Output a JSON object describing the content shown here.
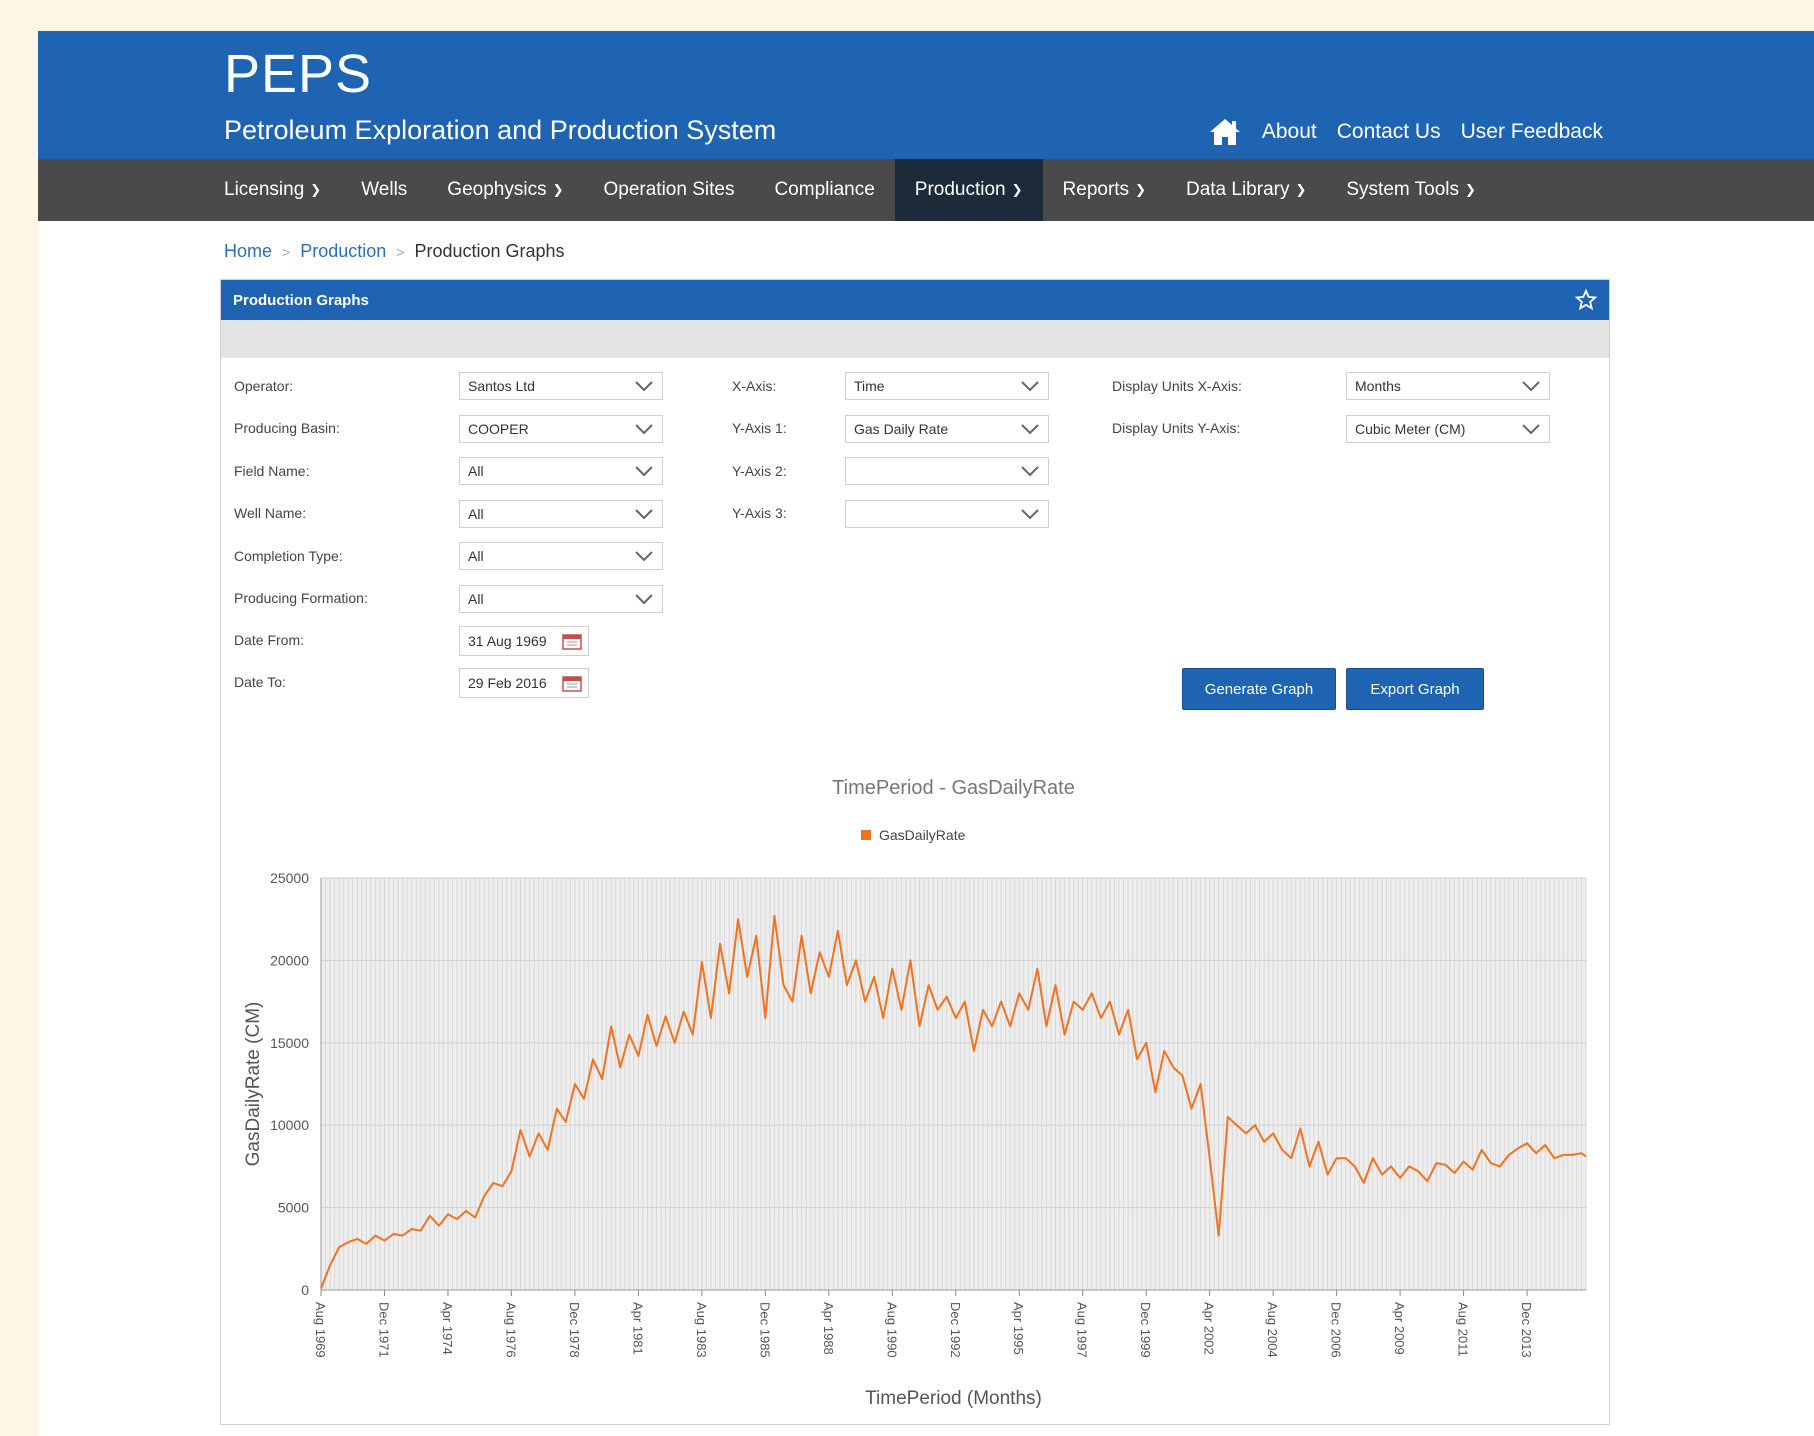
{
  "header": {
    "title": "PEPS",
    "subtitle": "Petroleum Exploration and Production System",
    "links": [
      "About",
      "Contact Us",
      "User Feedback"
    ]
  },
  "nav": {
    "items": [
      {
        "label": "Licensing",
        "dropdown": true
      },
      {
        "label": "Wells",
        "dropdown": false
      },
      {
        "label": "Geophysics",
        "dropdown": true
      },
      {
        "label": "Operation Sites",
        "dropdown": false
      },
      {
        "label": "Compliance",
        "dropdown": false
      },
      {
        "label": "Production",
        "dropdown": true,
        "active": true
      },
      {
        "label": "Reports",
        "dropdown": true
      },
      {
        "label": "Data Library",
        "dropdown": true
      },
      {
        "label": "System Tools",
        "dropdown": true
      }
    ]
  },
  "breadcrumb": {
    "home": "Home",
    "section": "Production",
    "current": "Production Graphs"
  },
  "panel": {
    "title": "Production Graphs"
  },
  "form": {
    "operator": {
      "label": "Operator:",
      "value": "Santos Ltd"
    },
    "basin": {
      "label": "Producing Basin:",
      "value": "COOPER"
    },
    "field": {
      "label": "Field Name:",
      "value": "All"
    },
    "well": {
      "label": "Well Name:",
      "value": "All"
    },
    "completion": {
      "label": "Completion Type:",
      "value": "All"
    },
    "formation": {
      "label": "Producing Formation:",
      "value": "All"
    },
    "date_from": {
      "label": "Date From:",
      "value": "31 Aug 1969"
    },
    "date_to": {
      "label": "Date To:",
      "value": "29 Feb 2016"
    },
    "x_axis": {
      "label": "X-Axis:",
      "value": "Time"
    },
    "y_axis1": {
      "label": "Y-Axis 1:",
      "value": "Gas Daily Rate"
    },
    "y_axis2": {
      "label": "Y-Axis 2:",
      "value": ""
    },
    "y_axis3": {
      "label": "Y-Axis 3:",
      "value": ""
    },
    "units_x": {
      "label": "Display Units X-Axis:",
      "value": "Months"
    },
    "units_y": {
      "label": "Display Units Y-Axis:",
      "value": "Cubic Meter (CM)"
    },
    "generate_label": "Generate Graph",
    "export_label": "Export Graph"
  },
  "colors": {
    "brand": "#1f64b2",
    "series": "#f0731f",
    "nav": "#4a4a4a"
  },
  "chart_data": {
    "type": "line",
    "title": "TimePeriod - GasDailyRate",
    "xlabel": "TimePeriod (Months)",
    "ylabel": "GasDailyRate (CM)",
    "ylim": [
      0,
      25000
    ],
    "yticks": [
      0,
      5000,
      10000,
      15000,
      20000,
      25000
    ],
    "xticks": [
      "Aug 1969",
      "Dec 1971",
      "Apr 1974",
      "Aug 1976",
      "Dec 1978",
      "Apr 1981",
      "Aug 1983",
      "Dec 1985",
      "Apr 1988",
      "Aug 1990",
      "Dec 1992",
      "Apr 1995",
      "Aug 1997",
      "Dec 1999",
      "Apr 2002",
      "Aug 2004",
      "Dec 2006",
      "Apr 2009",
      "Aug 2011",
      "Dec 2013"
    ],
    "legend": "top-center",
    "grid": true,
    "series": [
      {
        "name": "GasDailyRate",
        "x": [
          "Aug 1969",
          "Dec 1969",
          "Apr 1970",
          "Aug 1970",
          "Dec 1970",
          "Apr 1971",
          "Aug 1971",
          "Dec 1971",
          "Apr 1972",
          "Aug 1972",
          "Dec 1972",
          "Apr 1973",
          "Aug 1973",
          "Dec 1973",
          "Apr 1974",
          "Aug 1974",
          "Dec 1974",
          "Apr 1975",
          "Aug 1975",
          "Dec 1975",
          "Apr 1976",
          "Aug 1976",
          "Dec 1976",
          "Apr 1977",
          "Aug 1977",
          "Dec 1977",
          "Apr 1978",
          "Aug 1978",
          "Dec 1978",
          "Apr 1979",
          "Aug 1979",
          "Dec 1979",
          "Apr 1980",
          "Aug 1980",
          "Dec 1980",
          "Apr 1981",
          "Aug 1981",
          "Dec 1981",
          "Apr 1982",
          "Aug 1982",
          "Dec 1982",
          "Apr 1983",
          "Aug 1983",
          "Dec 1983",
          "Apr 1984",
          "Aug 1984",
          "Dec 1984",
          "Apr 1985",
          "Aug 1985",
          "Dec 1985",
          "Apr 1986",
          "Aug 1986",
          "Dec 1986",
          "Apr 1987",
          "Aug 1987",
          "Dec 1987",
          "Apr 1988",
          "Aug 1988",
          "Dec 1988",
          "Apr 1989",
          "Aug 1989",
          "Dec 1989",
          "Apr 1990",
          "Aug 1990",
          "Dec 1990",
          "Apr 1991",
          "Aug 1991",
          "Dec 1991",
          "Apr 1992",
          "Aug 1992",
          "Dec 1992",
          "Apr 1993",
          "Aug 1993",
          "Dec 1993",
          "Apr 1994",
          "Aug 1994",
          "Dec 1994",
          "Apr 1995",
          "Aug 1995",
          "Dec 1995",
          "Apr 1996",
          "Aug 1996",
          "Dec 1996",
          "Apr 1997",
          "Aug 1997",
          "Dec 1997",
          "Apr 1998",
          "Aug 1998",
          "Dec 1998",
          "Apr 1999",
          "Aug 1999",
          "Dec 1999",
          "Apr 2000",
          "Aug 2000",
          "Dec 2000",
          "Apr 2001",
          "Aug 2001",
          "Dec 2001",
          "Apr 2002",
          "Aug 2002",
          "Dec 2002",
          "Apr 2003",
          "Aug 2003",
          "Dec 2003",
          "Apr 2004",
          "Aug 2004",
          "Dec 2004",
          "Apr 2005",
          "Aug 2005",
          "Dec 2005",
          "Apr 2006",
          "Aug 2006",
          "Dec 2006",
          "Apr 2007",
          "Aug 2007",
          "Dec 2007",
          "Apr 2008",
          "Aug 2008",
          "Dec 2008",
          "Apr 2009",
          "Aug 2009",
          "Dec 2009",
          "Apr 2010",
          "Aug 2010",
          "Dec 2010",
          "Apr 2011",
          "Aug 2011",
          "Dec 2011",
          "Apr 2012",
          "Aug 2012",
          "Dec 2012",
          "Apr 2013",
          "Aug 2013",
          "Dec 2013",
          "Apr 2014",
          "Aug 2014",
          "Dec 2014",
          "Apr 2015",
          "Aug 2015",
          "Dec 2015",
          "Feb 2016"
        ],
        "values": [
          100,
          1500,
          2600,
          2900,
          3100,
          2800,
          3300,
          3000,
          3400,
          3300,
          3700,
          3600,
          4500,
          3900,
          4600,
          4300,
          4800,
          4400,
          5700,
          6500,
          6300,
          7200,
          9700,
          8100,
          9500,
          8500,
          11000,
          10200,
          12500,
          11600,
          14000,
          12800,
          16000,
          13500,
          15500,
          14200,
          16700,
          14800,
          16600,
          15000,
          16900,
          15500,
          19900,
          16500,
          21000,
          18000,
          22500,
          19000,
          21500,
          16500,
          22700,
          18500,
          17500,
          21500,
          18000,
          20500,
          19000,
          21800,
          18500,
          20000,
          17500,
          19000,
          16500,
          19500,
          17000,
          20000,
          16000,
          18500,
          17000,
          17800,
          16500,
          17500,
          14500,
          17000,
          16000,
          17500,
          16000,
          18000,
          17000,
          19500,
          16000,
          18500,
          15500,
          17500,
          17000,
          18000,
          16500,
          17500,
          15500,
          17000,
          14000,
          15000,
          12000,
          14500,
          13500,
          13000,
          11000,
          12500,
          8000,
          3300,
          10500,
          10000,
          9500,
          10000,
          9000,
          9500,
          8500,
          8000,
          9800,
          7500,
          9000,
          7000,
          8000,
          8000,
          7500,
          6500,
          8000,
          7000,
          7500,
          6800,
          7500,
          7200,
          6600,
          7700,
          7600,
          7100,
          7800,
          7300,
          8500,
          7700,
          7500,
          8200,
          8600,
          8900,
          8300,
          8800,
          8000,
          8200,
          8200,
          8300,
          8100
        ]
      }
    ]
  }
}
